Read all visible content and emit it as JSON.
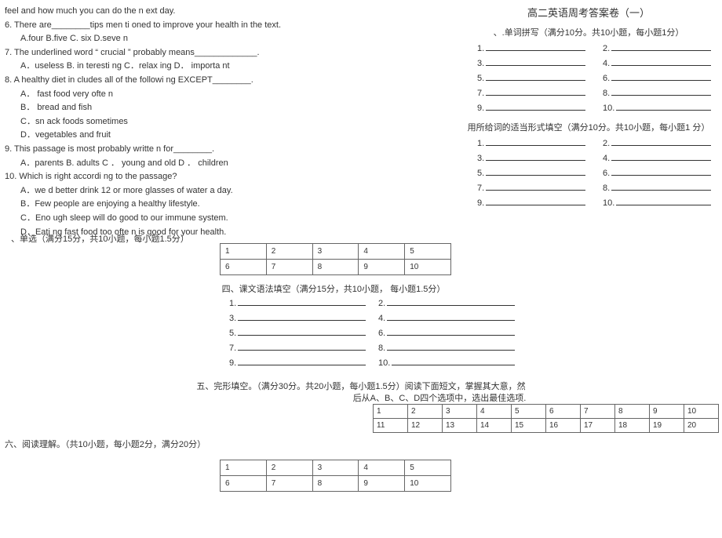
{
  "left": {
    "line0": "feel and how much you can do the n ext day.",
    "q6": {
      "stem": "6.  There are________tips men ti oned to improve your health in the text.",
      "opts": "A.four          B.five C. six D.seve n"
    },
    "q7": {
      "stem": "7.  The underlined word  “ crucial ”  probably means_____________.",
      "opts": "A．useless B. in teresti ng C．relax ing D．    importa nt"
    },
    "q8": {
      "stem": "8.  A healthy diet in cludes all of the followi ng EXCEPT________.",
      "a": "A．  fast food very ofte n",
      "b": "B．  bread and fish",
      "c": "C．sn ack foods sometimes",
      "d": "D．vegetables and fruit"
    },
    "q9": {
      "stem": "9.  This passage is most probably writte n for________.",
      "opts": "A．parents B. adults C ． young and old D ． children"
    },
    "q10": {
      "stem": "10.  Which is right accordi ng to the passage?",
      "a": "A．we d better drink 12 or more glasses of water a day.",
      "b": "B．Few people are enjoying a healthy lifestyle.",
      "c": "C．Eno ugh sleep will do good to our immune system.",
      "d": "D．Eati ng fast food too ofte n is good for your health."
    }
  },
  "right": {
    "title": "高二英语周考答案卷（一）",
    "sec1_head": "、.单词拼写（满分10分。共10小题，每小题1分）",
    "sec2_head": "用所给词的适当形式填空（满分10分。共10小题，每小题1 分）"
  },
  "sections": {
    "single_choice": "、单选（满分15分，共10小题，每小题1.5分）",
    "grammar": "四、课文语法填空（满分15分，共10小题，   每小题1.5分）",
    "cloze1": "五、完形填空。（满分30分。共20小题，每小题1.5分）阅读下面短文，掌握其大意，然",
    "cloze2": "后从A、B、C、D四个选项中，选出最佳选项.",
    "reading": "六、阅读理解。（共10小题，每小题2分，满分20分）"
  },
  "nums_1_10": [
    "1",
    "2",
    "3",
    "4",
    "5",
    "6",
    "7",
    "8",
    "9",
    "10"
  ],
  "nums_1_20": [
    "1",
    "2",
    "3",
    "4",
    "5",
    "6",
    "7",
    "8",
    "9",
    "10",
    "11",
    "12",
    "13",
    "14",
    "15",
    "16",
    "17",
    "18",
    "19",
    "20"
  ],
  "fill_labels": [
    "1.",
    "2.",
    "3.",
    "4.",
    "5.",
    "6.",
    "7.",
    "8.",
    "9.",
    "10."
  ]
}
